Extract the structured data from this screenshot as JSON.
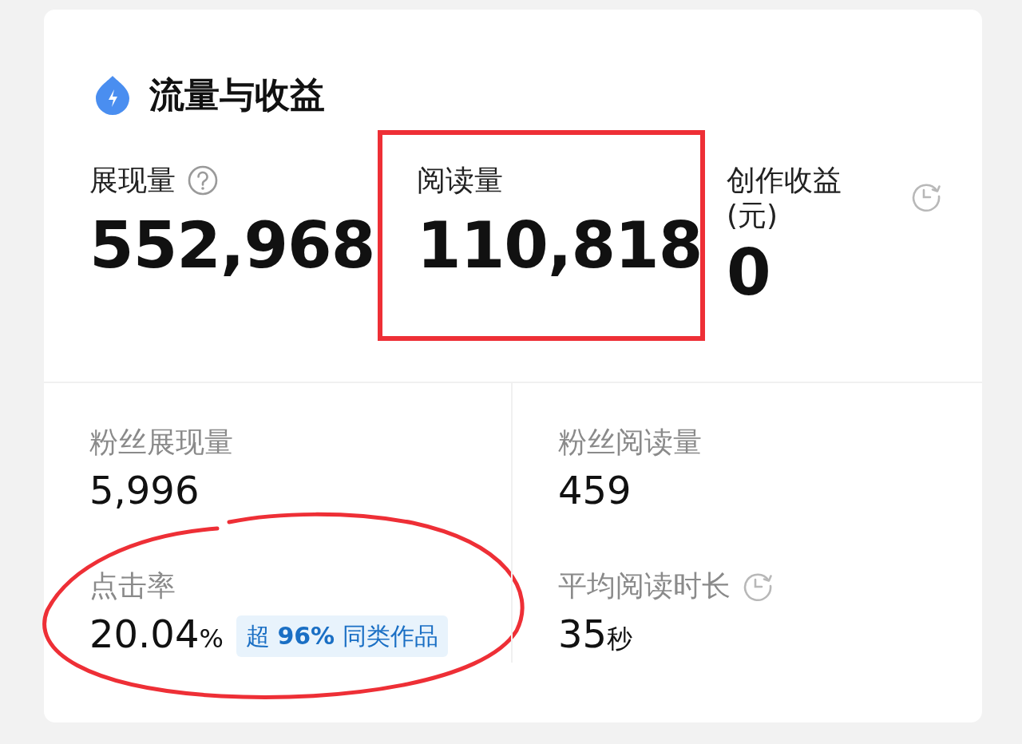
{
  "header": {
    "title": "流量与收益"
  },
  "main_stats": [
    {
      "kind": "help",
      "label": "展现量",
      "value": "552,968"
    },
    {
      "kind": "boxed",
      "label": "阅读量",
      "value": "110,818"
    },
    {
      "kind": "timed",
      "label": "创作收益(元)",
      "value": "0"
    }
  ],
  "secondary_stats": [
    {
      "kind": "plain",
      "label": "粉丝展现量",
      "value": "5,996"
    },
    {
      "kind": "plain",
      "label": "粉丝阅读量",
      "value": "459"
    },
    {
      "kind": "circled",
      "label": "点击率",
      "value": "20.04",
      "unit": "%",
      "badge": "超 **96%** 同类作品"
    },
    {
      "kind": "timed",
      "label": "平均阅读时长",
      "value": "35",
      "unit": "秒"
    }
  ]
}
